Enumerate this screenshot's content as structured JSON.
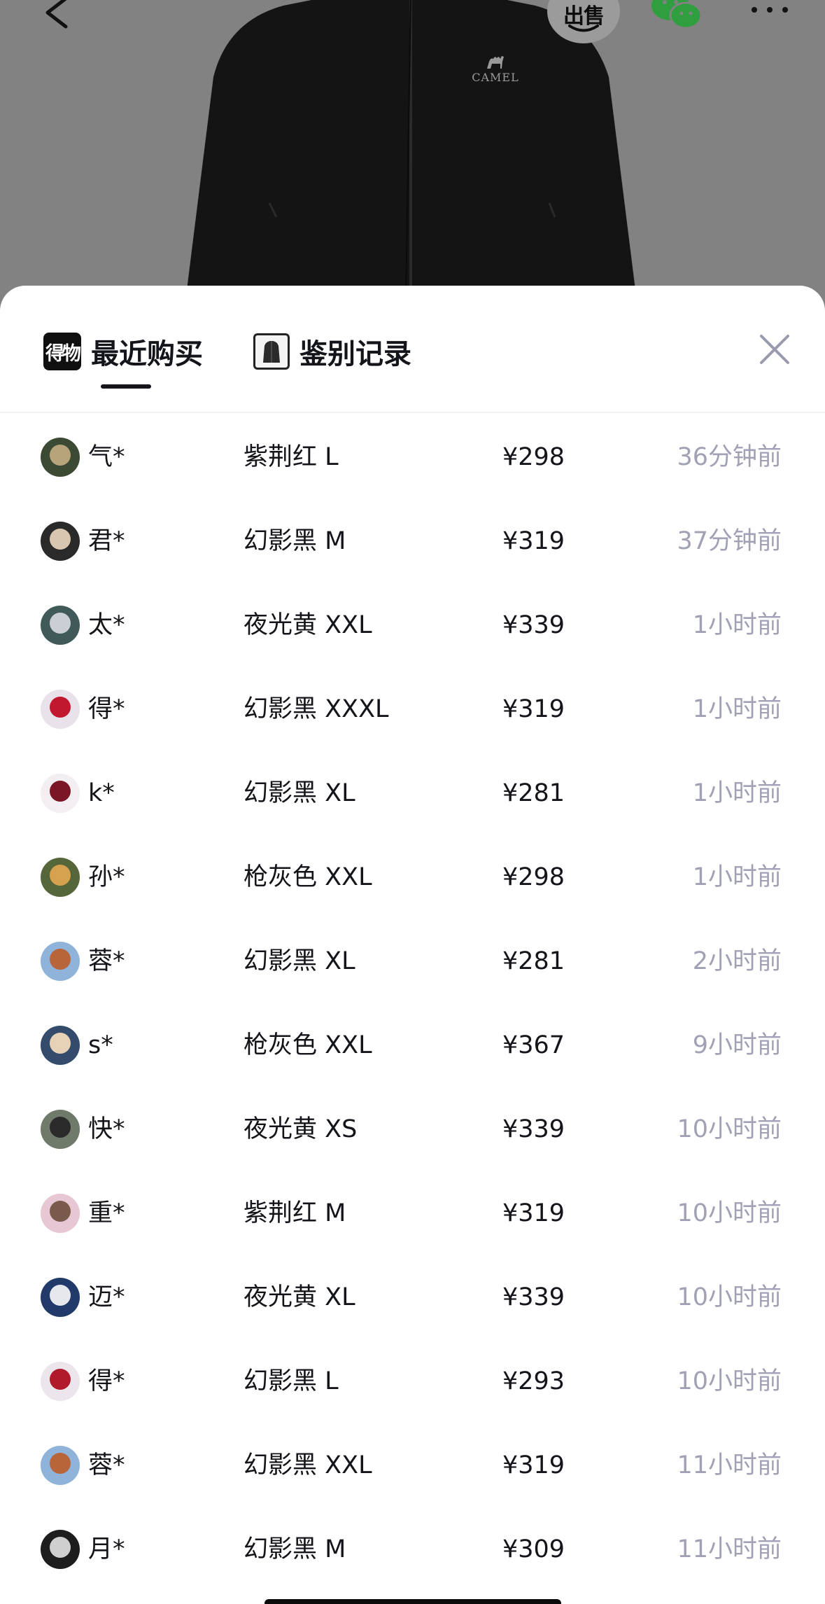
{
  "colors": {
    "dim_overlay": "#828282",
    "sheet_background": "#ffffff",
    "primary_text": "#14151a",
    "secondary_text": "#a1a1b6",
    "wechat_green": "#2f9e3f"
  },
  "top_bar": {
    "back_icon": "chevron-left-icon",
    "sell_label": "出售",
    "share_icon": "wechat-icon",
    "more_icon": "more-dots-icon"
  },
  "product": {
    "brand": "CAMEL"
  },
  "tabs": [
    {
      "icon_text": "得物",
      "label": "最近购买",
      "active": true
    },
    {
      "icon": "jacket-thumbnail",
      "label": "鉴别记录",
      "active": false
    }
  ],
  "close_icon": "close-icon",
  "purchases": [
    {
      "user": "气*",
      "spec": "紫荆红 L",
      "price": "¥298",
      "time": "36分钟前"
    },
    {
      "user": "君*",
      "spec": "幻影黑 M",
      "price": "¥319",
      "time": "37分钟前"
    },
    {
      "user": "太*",
      "spec": "夜光黄 XXL",
      "price": "¥339",
      "time": "1小时前"
    },
    {
      "user": "得*",
      "spec": "幻影黑 XXXL",
      "price": "¥319",
      "time": "1小时前"
    },
    {
      "user": "k*",
      "spec": "幻影黑 XL",
      "price": "¥281",
      "time": "1小时前"
    },
    {
      "user": "孙*",
      "spec": "枪灰色 XXL",
      "price": "¥298",
      "time": "1小时前"
    },
    {
      "user": "蓉*",
      "spec": "幻影黑 XL",
      "price": "¥281",
      "time": "2小时前"
    },
    {
      "user": "s*",
      "spec": "枪灰色 XXL",
      "price": "¥367",
      "time": "9小时前"
    },
    {
      "user": "快*",
      "spec": "夜光黄 XS",
      "price": "¥339",
      "time": "10小时前"
    },
    {
      "user": "重*",
      "spec": "紫荆红 M",
      "price": "¥319",
      "time": "10小时前"
    },
    {
      "user": "迈*",
      "spec": "夜光黄 XL",
      "price": "¥339",
      "time": "10小时前"
    },
    {
      "user": "得*",
      "spec": "幻影黑 L",
      "price": "¥293",
      "time": "10小时前"
    },
    {
      "user": "蓉*",
      "spec": "幻影黑 XXL",
      "price": "¥319",
      "time": "11小时前"
    },
    {
      "user": "月*",
      "spec": "幻影黑 M",
      "price": "¥309",
      "time": "11小时前"
    }
  ]
}
